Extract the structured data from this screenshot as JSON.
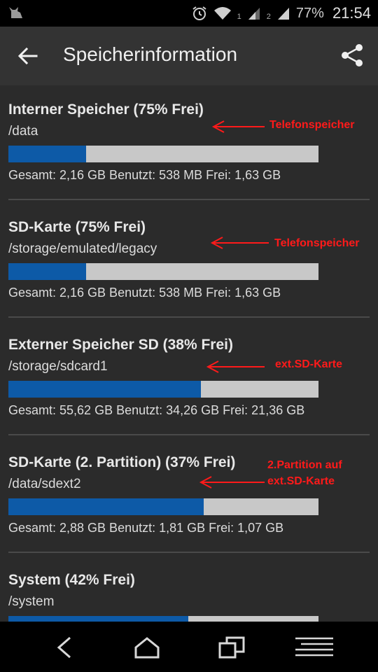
{
  "status_bar": {
    "sim1": "1",
    "sim2": "2",
    "battery": "77%",
    "time": "21:54"
  },
  "app_bar": {
    "title": "Speicherinformation"
  },
  "sections": [
    {
      "name": "Interner Speicher (75% Frei)",
      "path": "/data",
      "used_fraction": 0.25,
      "stats": "Gesamt: 2,16 GB Benutzt: 538 MB Frei: 1,63 GB"
    },
    {
      "name": "SD-Karte (75% Frei)",
      "path": "/storage/emulated/legacy",
      "used_fraction": 0.25,
      "stats": "Gesamt: 2,16 GB Benutzt: 538 MB Frei: 1,63 GB"
    },
    {
      "name": "Externer Speicher SD (38% Frei)",
      "path": "/storage/sdcard1",
      "used_fraction": 0.62,
      "stats": "Gesamt: 55,62 GB Benutzt: 34,26 GB Frei: 21,36 GB"
    },
    {
      "name": "SD-Karte (2. Partition) (37% Frei)",
      "path": "/data/sdext2",
      "used_fraction": 0.63,
      "stats": "Gesamt: 2,88 GB Benutzt: 1,81 GB Frei: 1,07 GB"
    },
    {
      "name": "System (42% Frei)",
      "path": "/system",
      "used_fraction": 0.58,
      "stats": ""
    }
  ],
  "annotations": [
    {
      "line1": "Telefonspeicher",
      "line2": ""
    },
    {
      "line1": "Telefonspeicher",
      "line2": ""
    },
    {
      "line1": "ext.SD-Karte",
      "line2": ""
    },
    {
      "line1": "2.Partition auf",
      "line2": "ext.SD-Karte"
    }
  ],
  "colors": {
    "bar_used": "#0d5aa7",
    "bar_free": "#c8c8c8",
    "annotation": "#ff1a1a"
  },
  "icons": {
    "app": "cat-icon",
    "alarm": "alarm-clock-icon",
    "wifi": "wifi-icon",
    "signal": "cell-signal-icon",
    "back": "arrow-back-icon",
    "share": "share-icon",
    "nav_back": "nav-back-icon",
    "nav_home": "nav-home-icon",
    "nav_recents": "nav-recents-icon",
    "nav_menu": "nav-menu-icon"
  }
}
